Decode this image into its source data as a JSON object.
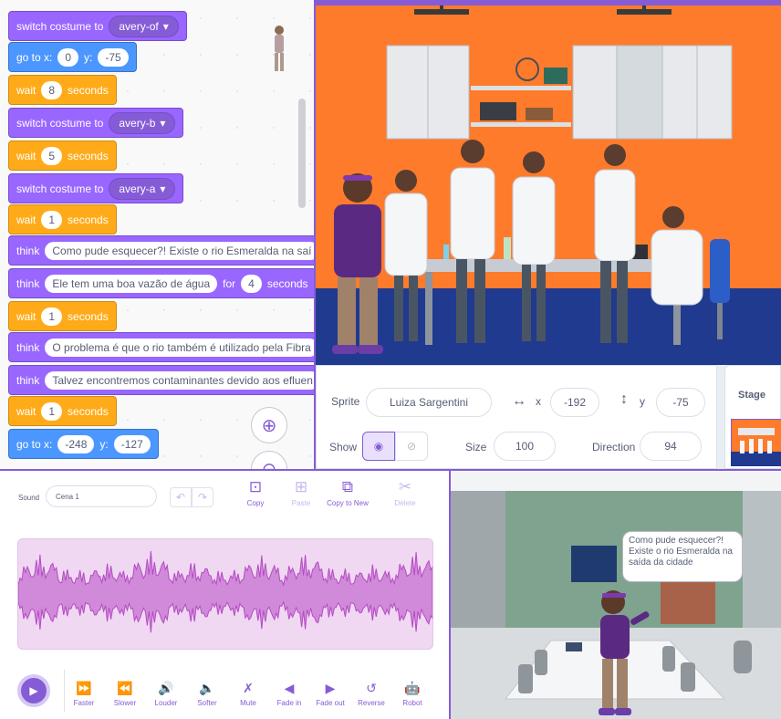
{
  "code": {
    "blocks": [
      {
        "type": "looks",
        "label": "switch costume to",
        "value": "avery-of",
        "dropdown": "▾"
      },
      {
        "type": "motion",
        "label": "go to x:",
        "x": "0",
        "ylabel": "y:",
        "y": "-75"
      },
      {
        "type": "control",
        "label": "wait",
        "value": "8",
        "suffix": "seconds"
      },
      {
        "type": "looks",
        "label": "switch costume to",
        "value": "avery-b",
        "dropdown": "▾"
      },
      {
        "type": "control",
        "label": "wait",
        "value": "5",
        "suffix": "seconds"
      },
      {
        "type": "looks",
        "label": "switch costume to",
        "value": "avery-a",
        "dropdown": "▾"
      },
      {
        "type": "control",
        "label": "wait",
        "value": "1",
        "suffix": "seconds"
      },
      {
        "type": "looks",
        "label": "think",
        "value": "Como pude esquecer?! Existe o rio Esmeralda na saí"
      },
      {
        "type": "looks",
        "label": "think",
        "value": "Ele tem uma boa vazão de água",
        "for_label": "for",
        "secs": "4",
        "suffix": "seconds"
      },
      {
        "type": "control",
        "label": "wait",
        "value": "1",
        "suffix": "seconds"
      },
      {
        "type": "looks",
        "label": "think",
        "value": "O problema é que o rio também é utilizado pela Fibra"
      },
      {
        "type": "looks",
        "label": "think",
        "value": "Talvez encontremos contaminantes devido aos efluen"
      },
      {
        "type": "control",
        "label": "wait",
        "value": "1",
        "suffix": "seconds"
      },
      {
        "type": "motion",
        "label": "go to x:",
        "x": "-248",
        "ylabel": "y:",
        "y": "-127"
      }
    ],
    "zoom_in_icon": "zoom-in-icon",
    "zoom_out_icon": "zoom-out-icon"
  },
  "sprite_info": {
    "sprite_label": "Sprite",
    "sprite_name": "Luiza Sargentini",
    "x_label": "x",
    "x_value": "-192",
    "y_label": "y",
    "y_value": "-75",
    "show_label": "Show",
    "size_label": "Size",
    "size_value": "100",
    "direction_label": "Direction",
    "direction_value": "94",
    "stage_label": "Stage"
  },
  "sound_editor": {
    "sound_label": "Sound",
    "sound_name": "Cena 1",
    "tools": [
      {
        "label": "Copy",
        "icon": "copy-icon",
        "enabled": true
      },
      {
        "label": "Paste",
        "icon": "paste-icon",
        "enabled": false
      },
      {
        "label": "Copy to New",
        "icon": "copy-to-new-icon",
        "enabled": true
      },
      {
        "label": "Delete",
        "icon": "scissors-icon",
        "enabled": false
      }
    ],
    "effects": [
      {
        "label": "Faster",
        "glyph": "⏩"
      },
      {
        "label": "Slower",
        "glyph": "⏪"
      },
      {
        "label": "Louder",
        "glyph": "🔊"
      },
      {
        "label": "Softer",
        "glyph": "🔈"
      },
      {
        "label": "Mute",
        "glyph": "✗"
      },
      {
        "label": "Fade in",
        "glyph": "◀"
      },
      {
        "label": "Fade out",
        "glyph": "▶"
      },
      {
        "label": "Reverse",
        "glyph": "↺"
      },
      {
        "label": "Robot",
        "glyph": "🤖"
      }
    ]
  },
  "meeting_scene": {
    "speech": "Como pude esquecer?! Existe o rio Esmeralda na saída da cidade"
  },
  "colors": {
    "looks": "#9966ff",
    "control": "#ffab19",
    "motion": "#4c97ff",
    "accent": "#855cd6",
    "lab_wall": "#ff7b2c",
    "lab_floor": "#1f3a8f",
    "meeting_wall": "#7fa38f"
  }
}
